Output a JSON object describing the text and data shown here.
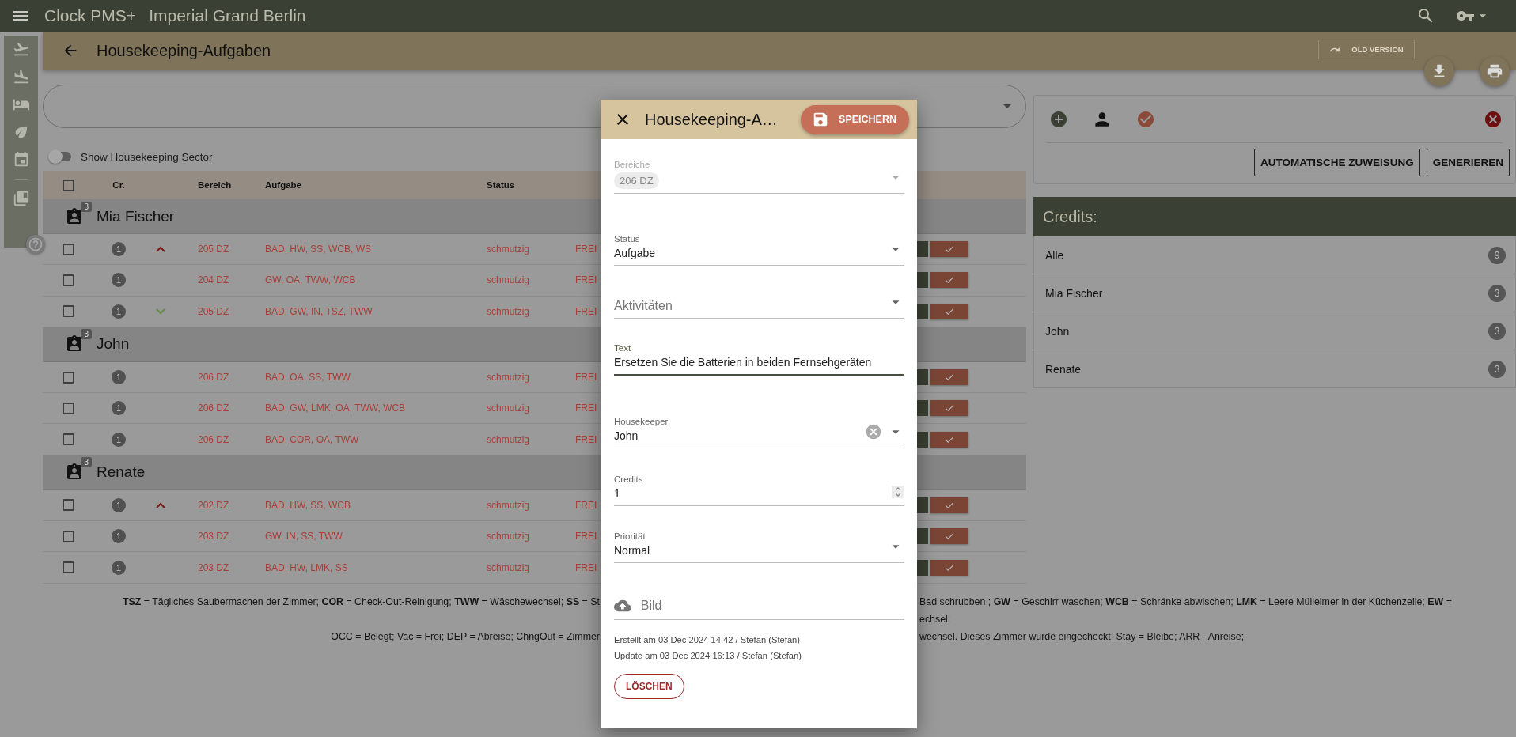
{
  "app": {
    "title": "Clock PMS+",
    "hotel": "Imperial Grand Berlin"
  },
  "page": {
    "title": "Housekeeping-Aufgaben",
    "old_version": "OLD VERSION"
  },
  "filter": {
    "toggle": {
      "label": "Show Housekeeping Sector",
      "on": false
    }
  },
  "table": {
    "columns": [
      "Cr.",
      "Bereich",
      "Aufgabe",
      "Status"
    ],
    "all_checked": false,
    "groups": [
      {
        "name": "Mia Fischer",
        "count": "3",
        "rows": [
          {
            "checked": false,
            "credits": "1",
            "kind": "high",
            "area": "205 DZ",
            "tasks": "BAD, HW, SS, WCB, WS",
            "status": "schmutzig",
            "room_status": "FREI"
          },
          {
            "checked": false,
            "credits": "1",
            "kind": "normal",
            "area": "204 DZ",
            "tasks": "GW, OA, TWW, WCB",
            "status": "schmutzig",
            "room_status": "FREI"
          },
          {
            "checked": false,
            "credits": "1",
            "kind": "low",
            "area": "205 DZ",
            "tasks": "BAD, GW, IN, TSZ, TWW",
            "status": "schmutzig",
            "room_status": "FREI"
          }
        ]
      },
      {
        "name": "John",
        "count": "3",
        "rows": [
          {
            "checked": false,
            "credits": "1",
            "kind": "normal",
            "area": "206 DZ",
            "tasks": "BAD, OA, SS, TWW",
            "status": "schmutzig",
            "room_status": "FREI"
          },
          {
            "checked": false,
            "credits": "1",
            "kind": "normal",
            "area": "206 DZ",
            "tasks": "BAD, GW, LMK, OA, TWW, WCB",
            "status": "schmutzig",
            "room_status": "FREI"
          },
          {
            "checked": false,
            "credits": "1",
            "kind": "normal",
            "area": "206 DZ",
            "tasks": "BAD, COR, OA, TWW",
            "status": "schmutzig",
            "room_status": "FREI"
          }
        ]
      },
      {
        "name": "Renate",
        "count": "3",
        "rows": [
          {
            "checked": false,
            "credits": "1",
            "kind": "high",
            "area": "202 DZ",
            "tasks": "BAD, HW, SS, WCB",
            "status": "schmutzig",
            "room_status": "FREI"
          },
          {
            "checked": false,
            "credits": "1",
            "kind": "normal",
            "area": "203 DZ",
            "tasks": "GW, IN, SS, TWW",
            "status": "schmutzig",
            "room_status": "FREI"
          },
          {
            "checked": false,
            "credits": "1",
            "kind": "normal",
            "area": "203 DZ",
            "tasks": "BAD, HW, LMK, SS",
            "status": "schmutzig",
            "room_status": "FREI"
          }
        ]
      }
    ]
  },
  "legend": [
    {
      "left": "**TSZ** = Tägliches Saubermachen der Zimmer; **COR** = Check-Out-Reinigung; **TWW** = Wäschewechsel; **SS** = St",
      "right": "Bad schrubben ; **GW** = Geschirr waschen; **WCB** = Schränke abwischen; **LMK** = Leere Mülleimer in der Küchenzeile; **EW** ="
    },
    {
      "right": "echsel;"
    },
    {
      "left": "OCC = Belegt; Vac = Frei; DEP = Abreise; ChngOut = Zimmer",
      "right": "wechsel. Dieses Zimmer wurde eingecheckt; Stay = Bleibe; ARR - Anreise;"
    }
  ],
  "actions": {
    "auto_assign": "AUTOMATISCHE ZUWEISUNG",
    "generate": "GENERIEREN"
  },
  "credits": {
    "title": "Credits:",
    "items": [
      {
        "name": "Alle",
        "count": "9"
      },
      {
        "name": "Mia Fischer",
        "count": "3"
      },
      {
        "name": "John",
        "count": "3"
      },
      {
        "name": "Renate",
        "count": "3"
      }
    ]
  },
  "dialog": {
    "title": "Housekeeping-A…",
    "save": "SPEICHERN",
    "fields": [
      {
        "kind": "chips",
        "label": "Bereiche",
        "chips": [
          "206 DZ"
        ],
        "disabled": true,
        "focused": false,
        "clearable": false
      },
      {
        "kind": "select",
        "label": "Status",
        "value": "Aufgabe",
        "disabled": false,
        "focused": false,
        "clearable": false
      },
      {
        "kind": "select",
        "placeholder": "Aktivitäten",
        "disabled": false,
        "focused": false,
        "clearable": false
      },
      {
        "kind": "text",
        "label": "Text",
        "value": "Ersetzen Sie die Batterien in beiden Fernsehgeräten",
        "disabled": false,
        "focused": true,
        "clearable": false
      },
      {
        "kind": "select",
        "label": "Housekeeper",
        "value": "John",
        "disabled": false,
        "focused": false,
        "clearable": true
      },
      {
        "kind": "number",
        "label": "Credits",
        "value": "1",
        "disabled": false,
        "focused": false,
        "clearable": false
      },
      {
        "kind": "select",
        "label": "Priorität",
        "value": "Normal",
        "disabled": false,
        "focused": false,
        "clearable": false
      },
      {
        "kind": "upload",
        "placeholder": "Bild",
        "disabled": false,
        "focused": false,
        "clearable": false
      }
    ],
    "created": "Erstellt am 03 Dec 2024 14:42 / Stefan (Stefan)",
    "updated": "Update am 03 Dec 2024 16:13 / Stefan (Stefan)",
    "delete": "LÖSCHEN"
  }
}
